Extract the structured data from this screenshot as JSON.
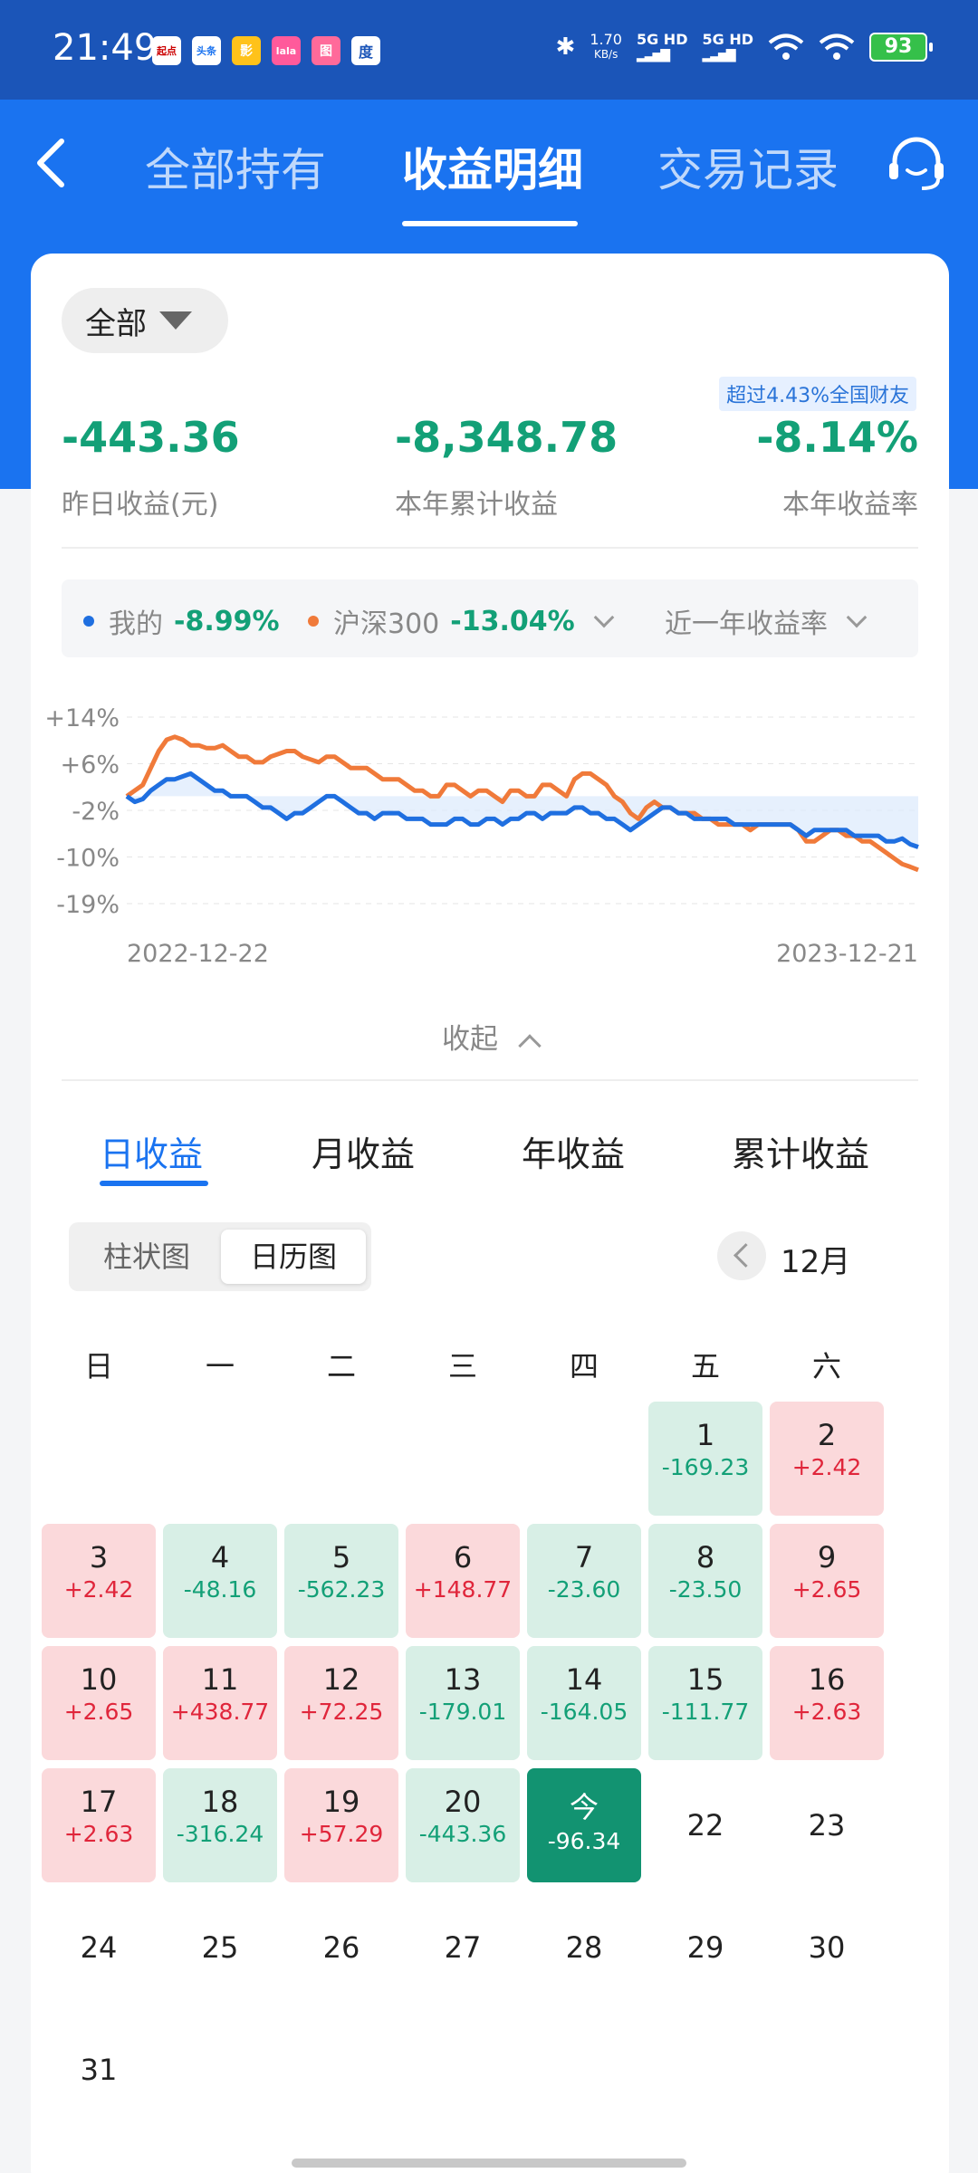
{
  "status_bar": {
    "time": "21:49",
    "apps": [
      "起点",
      "头条",
      "影",
      "lala",
      "图",
      "度"
    ],
    "net_speed_value": "1.70",
    "net_speed_unit": "KB/s",
    "sim1": "5G HD",
    "sim2": "5G HD",
    "battery": "93"
  },
  "header": {
    "tabs": [
      {
        "label": "全部持有"
      },
      {
        "label": "收益明细"
      },
      {
        "label": "交易记录"
      }
    ],
    "active_tab": 1
  },
  "filter": {
    "label": "全部"
  },
  "rank_badge": "超过4.43%全国财友",
  "metrics": [
    {
      "value": "-443.36",
      "label": "昨日收益(元)"
    },
    {
      "value": "-8,348.78",
      "label": "本年累计收益"
    },
    {
      "value": "-8.14%",
      "label": "本年收益率"
    }
  ],
  "legend": {
    "mine_label": "我的",
    "mine_value": "-8.99%",
    "index_label": "沪深300",
    "index_value": "-13.04%",
    "period_label": "近一年收益率"
  },
  "chart_data": {
    "type": "line",
    "yticks": [
      "+14%",
      "+6%",
      "-2%",
      "-10%",
      "-19%"
    ],
    "ylim": [
      -19,
      14
    ],
    "x_start_label": "2022-12-22",
    "x_end_label": "2023-12-21",
    "series": [
      {
        "name": "我的",
        "color": "#1f6fe0",
        "values": [
          0,
          -1,
          -0.5,
          1,
          2,
          3,
          3,
          3.5,
          4,
          3,
          2,
          1,
          1,
          0,
          0,
          0,
          -1,
          -2,
          -2,
          -3,
          -4,
          -3,
          -3,
          -2,
          -1,
          0,
          0,
          -1,
          -2,
          -3,
          -3,
          -4,
          -3,
          -3,
          -3,
          -4,
          -4,
          -4,
          -5,
          -5,
          -5,
          -4,
          -4,
          -5,
          -5,
          -4,
          -4,
          -5,
          -4,
          -4,
          -3,
          -3,
          -4,
          -3,
          -3,
          -3,
          -2,
          -2,
          -3,
          -3,
          -4,
          -4,
          -5,
          -6,
          -5,
          -4,
          -3,
          -2,
          -2,
          -3,
          -3,
          -4,
          -4,
          -4,
          -4,
          -4,
          -5,
          -5,
          -5,
          -5,
          -5,
          -5,
          -5,
          -5,
          -6,
          -7,
          -6,
          -6,
          -6,
          -6,
          -6,
          -7,
          -7,
          -7,
          -7,
          -8,
          -8,
          -7.5,
          -8.5,
          -8.99
        ]
      },
      {
        "name": "沪深300",
        "color": "#f07a3a",
        "values": [
          0,
          1,
          2,
          5,
          8,
          10,
          10.5,
          10,
          9,
          9,
          8.5,
          8.5,
          9,
          8,
          7,
          7,
          6,
          6,
          7,
          7.5,
          8,
          8,
          7,
          6.5,
          6,
          7,
          7,
          6,
          5,
          5,
          5,
          4,
          3,
          3,
          3,
          2,
          1,
          1,
          0,
          0,
          2,
          2,
          1,
          0,
          1,
          1,
          0,
          -1,
          1,
          1,
          0,
          0,
          2,
          2,
          1,
          0,
          3,
          4,
          4,
          3,
          2,
          0,
          -1,
          -3,
          -4,
          -2,
          -1,
          -2,
          -2,
          -3,
          -3,
          -3,
          -4,
          -4,
          -5,
          -5,
          -5,
          -5,
          -6,
          -5,
          -5,
          -5,
          -5,
          -5,
          -6,
          -8,
          -8,
          -7,
          -6,
          -6,
          -7,
          -7,
          -8,
          -8,
          -9,
          -10,
          -11,
          -12,
          -12.5,
          -13.04
        ]
      }
    ]
  },
  "collapse_label": "收起",
  "period_tabs": [
    {
      "label": "日收益"
    },
    {
      "label": "月收益"
    },
    {
      "label": "年收益"
    },
    {
      "label": "累计收益"
    }
  ],
  "view_toggle": {
    "options": [
      "柱状图",
      "日历图"
    ],
    "selected": "日历图"
  },
  "month_label": "12月",
  "weekdays": [
    "日",
    "一",
    "二",
    "三",
    "四",
    "五",
    "六"
  ],
  "calendar": [
    {
      "day": "1",
      "value": "-169.23",
      "status": "loss"
    },
    {
      "day": "2",
      "value": "+2.42",
      "status": "gain"
    },
    {
      "day": "3",
      "value": "+2.42",
      "status": "gain"
    },
    {
      "day": "4",
      "value": "-48.16",
      "status": "loss"
    },
    {
      "day": "5",
      "value": "-562.23",
      "status": "loss"
    },
    {
      "day": "6",
      "value": "+148.77",
      "status": "gain"
    },
    {
      "day": "7",
      "value": "-23.60",
      "status": "loss"
    },
    {
      "day": "8",
      "value": "-23.50",
      "status": "loss"
    },
    {
      "day": "9",
      "value": "+2.65",
      "status": "gain"
    },
    {
      "day": "10",
      "value": "+2.65",
      "status": "gain"
    },
    {
      "day": "11",
      "value": "+438.77",
      "status": "gain"
    },
    {
      "day": "12",
      "value": "+72.25",
      "status": "gain"
    },
    {
      "day": "13",
      "value": "-179.01",
      "status": "loss"
    },
    {
      "day": "14",
      "value": "-164.05",
      "status": "loss"
    },
    {
      "day": "15",
      "value": "-111.77",
      "status": "loss"
    },
    {
      "day": "16",
      "value": "+2.63",
      "status": "gain"
    },
    {
      "day": "17",
      "value": "+2.63",
      "status": "gain"
    },
    {
      "day": "18",
      "value": "-316.24",
      "status": "loss"
    },
    {
      "day": "19",
      "value": "+57.29",
      "status": "gain"
    },
    {
      "day": "20",
      "value": "-443.36",
      "status": "loss"
    },
    {
      "day": "今",
      "value": "-96.34",
      "status": "today"
    },
    {
      "day": "22",
      "value": "",
      "status": "plain"
    },
    {
      "day": "23",
      "value": "",
      "status": "plain"
    },
    {
      "day": "24",
      "value": "",
      "status": "plain"
    },
    {
      "day": "25",
      "value": "",
      "status": "plain"
    },
    {
      "day": "26",
      "value": "",
      "status": "plain"
    },
    {
      "day": "27",
      "value": "",
      "status": "plain"
    },
    {
      "day": "28",
      "value": "",
      "status": "plain"
    },
    {
      "day": "29",
      "value": "",
      "status": "plain"
    },
    {
      "day": "30",
      "value": "",
      "status": "plain"
    },
    {
      "day": "31",
      "value": "",
      "status": "plain"
    }
  ],
  "colors": {
    "brand_blue": "#1a73f0",
    "loss_green": "#13a077",
    "gain_red": "#e0263b",
    "today_bg": "#129371"
  }
}
